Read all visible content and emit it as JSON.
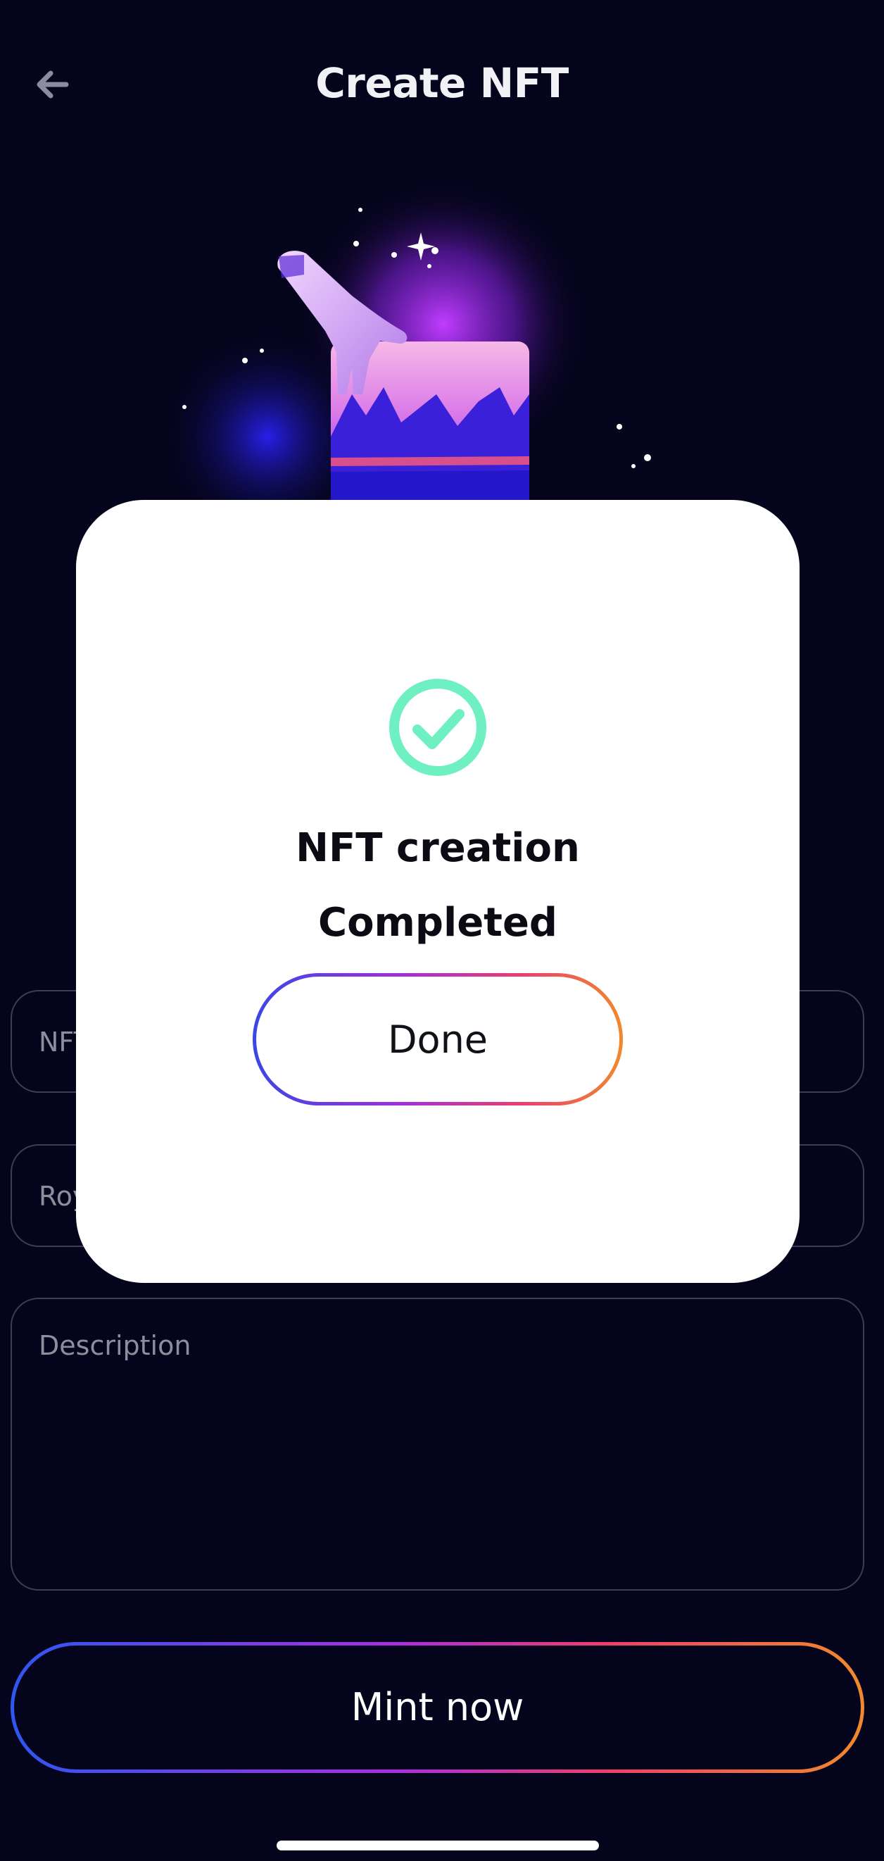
{
  "header": {
    "title": "Create NFT",
    "back_icon": "arrow-left-icon"
  },
  "form": {
    "name_placeholder": "NFT name",
    "royalties_placeholder": "Royalties",
    "description_placeholder": "Description"
  },
  "mint_button": {
    "label": "Mint now"
  },
  "modal": {
    "icon": "check-circle-icon",
    "title_line1": "NFT creation",
    "title_line2": "Completed",
    "done_label": "Done"
  },
  "colors": {
    "background": "#05041d",
    "success": "#6ef0c2",
    "gradient_start": "#2f56f0",
    "gradient_mid": "#a92ee0",
    "gradient_end": "#f08a2c"
  }
}
